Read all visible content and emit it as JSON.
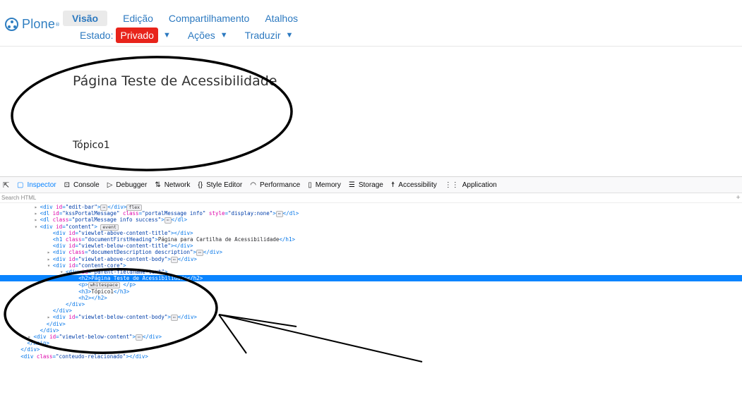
{
  "toolbar": {
    "logo_text": "Plone",
    "logo_mark": "®",
    "tabs": [
      {
        "label": "Visão"
      },
      {
        "label": "Edição"
      },
      {
        "label": "Compartilhamento"
      },
      {
        "label": "Atalhos"
      }
    ],
    "state_label": "Estado:",
    "state_value": "Privado",
    "state_color": "#e8241b",
    "actions_label": "Ações",
    "translate_label": "Traduzir",
    "accent_color": "#2c79c0"
  },
  "page": {
    "title": "Página Teste de Acessibilidade",
    "topic": "Tópico1"
  },
  "devtools": {
    "tabs": [
      {
        "label": "Inspector",
        "icon": "inspector-icon",
        "glyph": "▢"
      },
      {
        "label": "Console",
        "icon": "console-icon",
        "glyph": "⊡"
      },
      {
        "label": "Debugger",
        "icon": "debugger-icon",
        "glyph": "▷"
      },
      {
        "label": "Network",
        "icon": "network-icon",
        "glyph": "⇅"
      },
      {
        "label": "Style Editor",
        "icon": "style-editor-icon",
        "glyph": "{}"
      },
      {
        "label": "Performance",
        "icon": "performance-icon",
        "glyph": "◠"
      },
      {
        "label": "Memory",
        "icon": "memory-icon",
        "glyph": "▯"
      },
      {
        "label": "Storage",
        "icon": "storage-icon",
        "glyph": "☰"
      },
      {
        "label": "Accessibility",
        "icon": "accessibility-icon",
        "glyph": "☨"
      },
      {
        "label": "Application",
        "icon": "application-icon",
        "glyph": "⋮⋮"
      }
    ],
    "selected_tab": "Inspector",
    "search_placeholder": "Search HTML",
    "highlight_color": "#0a84ff",
    "dom_lines": [
      {
        "indent": 6,
        "toggle": "▸",
        "parts": [
          [
            "tg",
            "<div "
          ],
          [
            "an",
            "id"
          ],
          [
            "tg",
            "="
          ],
          [
            "av",
            "\"edit-bar\""
          ],
          [
            "tg",
            ">"
          ],
          [
            "pill",
            "⋯"
          ],
          [
            "tg",
            "</div>"
          ],
          [
            "pill",
            "flex"
          ]
        ]
      },
      {
        "indent": 6,
        "toggle": "▸",
        "parts": [
          [
            "tg",
            "<dl "
          ],
          [
            "an",
            "id"
          ],
          [
            "tg",
            "="
          ],
          [
            "av",
            "\"kssPortalMessage\""
          ],
          [
            "tg",
            " "
          ],
          [
            "an",
            "class"
          ],
          [
            "tg",
            "="
          ],
          [
            "av",
            "\"portalMessage info\""
          ],
          [
            "tg",
            " "
          ],
          [
            "an",
            "style"
          ],
          [
            "tg",
            "="
          ],
          [
            "av",
            "\"display:none\""
          ],
          [
            "tg",
            ">"
          ],
          [
            "pill",
            "⋯"
          ],
          [
            "tg",
            "</dl>"
          ]
        ]
      },
      {
        "indent": 6,
        "toggle": "▸",
        "parts": [
          [
            "tg",
            "<dl "
          ],
          [
            "an",
            "class"
          ],
          [
            "tg",
            "="
          ],
          [
            "av",
            "\"portalMessage info success\""
          ],
          [
            "tg",
            ">"
          ],
          [
            "pill",
            "⋯"
          ],
          [
            "tg",
            "</dl>"
          ]
        ]
      },
      {
        "indent": 6,
        "toggle": "▾",
        "parts": [
          [
            "tg",
            "<div "
          ],
          [
            "an",
            "id"
          ],
          [
            "tg",
            "="
          ],
          [
            "av",
            "\"content\""
          ],
          [
            "tg",
            "> "
          ],
          [
            "pill",
            "event"
          ]
        ]
      },
      {
        "indent": 8,
        "toggle": "",
        "parts": [
          [
            "tg",
            "<div "
          ],
          [
            "an",
            "id"
          ],
          [
            "tg",
            "="
          ],
          [
            "av",
            "\"viewlet-above-content-title\""
          ],
          [
            "tg",
            "></div>"
          ]
        ]
      },
      {
        "indent": 8,
        "toggle": "",
        "parts": [
          [
            "tg",
            "<h1 "
          ],
          [
            "an",
            "class"
          ],
          [
            "tg",
            "="
          ],
          [
            "av",
            "\"documentFirstHeading\""
          ],
          [
            "tg",
            ">"
          ],
          [
            "tx",
            "Página para Cartilha de Acessibilidade"
          ],
          [
            "tg",
            "</h1>"
          ]
        ]
      },
      {
        "indent": 8,
        "toggle": "",
        "parts": [
          [
            "tg",
            "<div "
          ],
          [
            "an",
            "id"
          ],
          [
            "tg",
            "="
          ],
          [
            "av",
            "\"viewlet-below-content-title\""
          ],
          [
            "tg",
            "></div>"
          ]
        ]
      },
      {
        "indent": 8,
        "toggle": "▸",
        "parts": [
          [
            "tg",
            "<div "
          ],
          [
            "an",
            "class"
          ],
          [
            "tg",
            "="
          ],
          [
            "av",
            "\"documentDescription description\""
          ],
          [
            "tg",
            ">"
          ],
          [
            "pill",
            "⋯"
          ],
          [
            "tg",
            "</div>"
          ]
        ]
      },
      {
        "indent": 8,
        "toggle": "▸",
        "parts": [
          [
            "tg",
            "<div "
          ],
          [
            "an",
            "id"
          ],
          [
            "tg",
            "="
          ],
          [
            "av",
            "\"viewlet-above-content-body\""
          ],
          [
            "tg",
            ">"
          ],
          [
            "pill",
            "⋯"
          ],
          [
            "tg",
            "</div>"
          ]
        ]
      },
      {
        "indent": 8,
        "toggle": "▾",
        "parts": [
          [
            "tg",
            "<div "
          ],
          [
            "an",
            "id"
          ],
          [
            "tg",
            "="
          ],
          [
            "av",
            "\"content-core\""
          ],
          [
            "tg",
            ">"
          ]
        ]
      },
      {
        "indent": 10,
        "toggle": "▾",
        "parts": [
          [
            "tg",
            "<div "
          ],
          [
            "an",
            "id"
          ],
          [
            "tg",
            "="
          ],
          [
            "av",
            "\"parent-fieldname-text\""
          ],
          [
            "tg",
            ">"
          ]
        ]
      },
      {
        "indent": 12,
        "toggle": "",
        "hl": true,
        "parts": [
          [
            "tg",
            "<h2>"
          ],
          [
            "tx",
            "Página Teste de Acessibilidade"
          ],
          [
            "tg",
            "</h2>"
          ]
        ]
      },
      {
        "indent": 12,
        "toggle": "",
        "parts": [
          [
            "tg",
            "<p>"
          ],
          [
            "pill",
            "whitespace"
          ],
          [
            "tg",
            " </p>"
          ]
        ]
      },
      {
        "indent": 12,
        "toggle": "",
        "parts": [
          [
            "tg",
            "<h3>"
          ],
          [
            "tx",
            "Tópico1"
          ],
          [
            "tg",
            "</h3>"
          ]
        ]
      },
      {
        "indent": 12,
        "toggle": "",
        "parts": [
          [
            "tg",
            "<h2></h2>"
          ]
        ]
      },
      {
        "indent": 10,
        "toggle": "",
        "parts": [
          [
            "tg",
            "</div>"
          ]
        ]
      },
      {
        "indent": 8,
        "toggle": "",
        "parts": [
          [
            "tg",
            "</div>"
          ]
        ]
      },
      {
        "indent": 8,
        "toggle": "▸",
        "parts": [
          [
            "tg",
            "<div "
          ],
          [
            "an",
            "id"
          ],
          [
            "tg",
            "="
          ],
          [
            "av",
            "\"viewlet-below-content-body\""
          ],
          [
            "tg",
            ">"
          ],
          [
            "pill",
            "⋯"
          ],
          [
            "tg",
            "</div>"
          ]
        ]
      },
      {
        "indent": 7,
        "toggle": "",
        "parts": [
          [
            "tg",
            "</div>"
          ]
        ]
      },
      {
        "indent": 6,
        "toggle": "",
        "parts": [
          [
            "tg",
            "</div>"
          ]
        ]
      },
      {
        "indent": 5,
        "toggle": "▸",
        "parts": [
          [
            "tg",
            "<div "
          ],
          [
            "an",
            "id"
          ],
          [
            "tg",
            "="
          ],
          [
            "av",
            "\"viewlet-below-content\""
          ],
          [
            "tg",
            ">"
          ],
          [
            "pill",
            "⋯"
          ],
          [
            "tg",
            "</div>"
          ]
        ]
      },
      {
        "indent": 4,
        "toggle": "",
        "parts": [
          [
            "tg",
            "</main>"
          ]
        ]
      },
      {
        "indent": 3,
        "toggle": "",
        "parts": [
          [
            "tg",
            "</div>"
          ]
        ]
      },
      {
        "indent": 3,
        "toggle": "",
        "parts": [
          [
            "tg",
            "<div "
          ],
          [
            "an",
            "class"
          ],
          [
            "tg",
            "="
          ],
          [
            "av",
            "\"conteudo-relacionado\""
          ],
          [
            "tg",
            "></div>"
          ]
        ]
      }
    ]
  }
}
